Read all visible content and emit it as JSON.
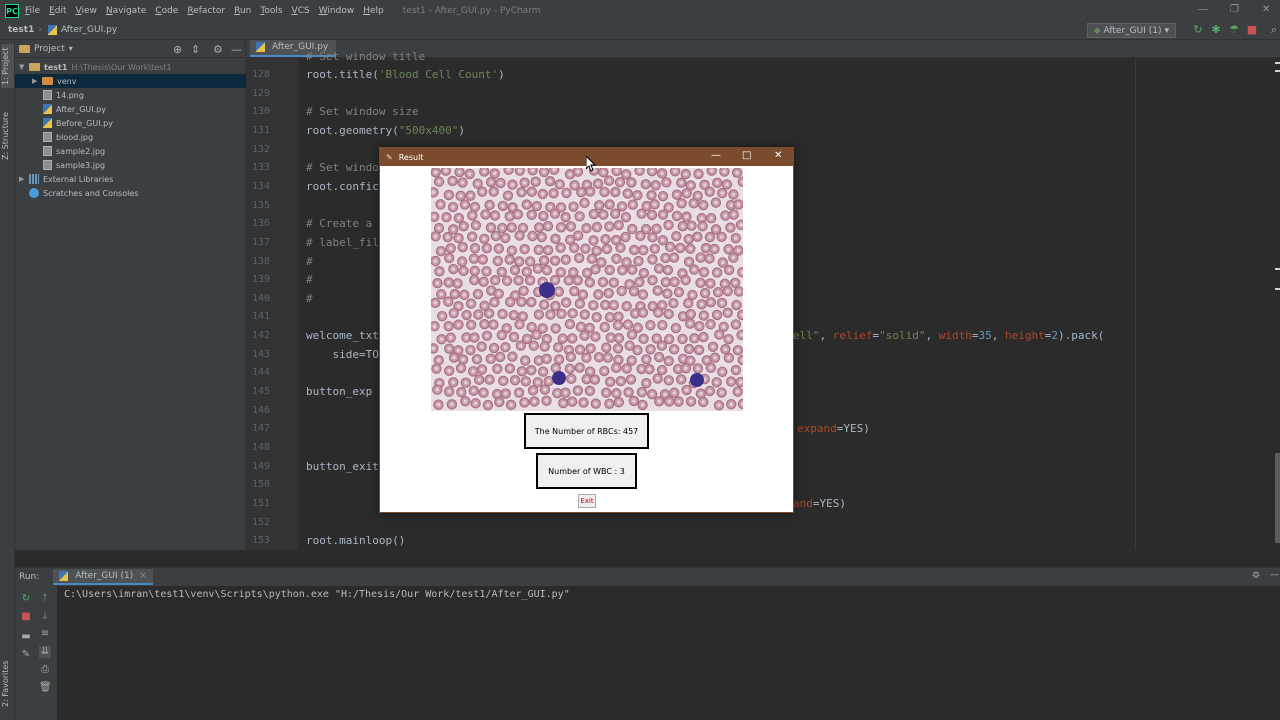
{
  "app": {
    "window_title": "test1 - After_GUI.py - PyCharm",
    "logo_text": "PC"
  },
  "menu": [
    {
      "label": "File",
      "mnemonic": "F",
      "rest": "ile"
    },
    {
      "label": "Edit",
      "mnemonic": "E",
      "rest": "dit"
    },
    {
      "label": "View",
      "mnemonic": "V",
      "rest": "iew"
    },
    {
      "label": "Navigate",
      "mnemonic": "N",
      "rest": "avigate"
    },
    {
      "label": "Code",
      "mnemonic": "C",
      "rest": "ode"
    },
    {
      "label": "Refactor",
      "mnemonic": "R",
      "rest": "efactor"
    },
    {
      "label": "Run",
      "mnemonic": "R",
      "rest": "un"
    },
    {
      "label": "Tools",
      "mnemonic": "T",
      "rest": "ools"
    },
    {
      "label": "VCS",
      "mnemonic": "V",
      "rest": "CS"
    },
    {
      "label": "Window",
      "mnemonic": "W",
      "rest": "indow"
    },
    {
      "label": "Help",
      "mnemonic": "H",
      "rest": "elp"
    }
  ],
  "navbar": {
    "project": "test1",
    "file": "After_GUI.py",
    "run_config": "After_GUI (1)"
  },
  "left_stripe": {
    "project_tab": "1: Project",
    "structure_tab": "Z: Structure",
    "favorites_tab": "2: Favorites"
  },
  "project_panel": {
    "title": "Project",
    "root": {
      "name": "test1",
      "path": "H:\\Thesis\\Our Work\\test1"
    },
    "items": [
      {
        "name": "venv",
        "kind": "folder"
      },
      {
        "name": "14.png",
        "kind": "image"
      },
      {
        "name": "After_GUI.py",
        "kind": "python"
      },
      {
        "name": "Before_GUI.py",
        "kind": "python"
      },
      {
        "name": "blood.jpg",
        "kind": "image"
      },
      {
        "name": "sample2.jpg",
        "kind": "image"
      },
      {
        "name": "sample3.jpg",
        "kind": "image"
      }
    ],
    "external_libraries": "External Libraries",
    "scratches": "Scratches and Consoles"
  },
  "editor": {
    "tab": "After_GUI.py",
    "top_partial": "# Set window title",
    "lines": [
      {
        "n": "128",
        "a": "root.title(",
        "b": "'Blood Cell Count'",
        "c": ")"
      },
      {
        "n": "129"
      },
      {
        "n": "130",
        "comment": "# Set window size"
      },
      {
        "n": "131",
        "a": "root.geometry(",
        "b": "\"500x400\"",
        "c": ")"
      },
      {
        "n": "132"
      },
      {
        "n": "133",
        "comment": "# Set windo"
      },
      {
        "n": "134",
        "a": "root.confic"
      },
      {
        "n": "135"
      },
      {
        "n": "136",
        "comment": "# Create a"
      },
      {
        "n": "137",
        "comment": "# label_fil"
      },
      {
        "n": "138",
        "comment": "#"
      },
      {
        "n": "139",
        "comment": "#"
      },
      {
        "n": "140",
        "comment": "#"
      },
      {
        "n": "141"
      },
      {
        "n": "142",
        "a": "welcome_txt"
      },
      {
        "n": "143",
        "a": "    side=TO"
      },
      {
        "n": "144"
      },
      {
        "n": "145",
        "a": "button_exp"
      },
      {
        "n": "146"
      },
      {
        "n": "147"
      },
      {
        "n": "148"
      },
      {
        "n": "149",
        "a": "button_exit"
      },
      {
        "n": "150"
      },
      {
        "n": "151"
      },
      {
        "n": "152"
      },
      {
        "n": "153",
        "a": "root.mainloop()"
      }
    ],
    "line142_right": {
      "s1": "ell\"",
      "s2": ", ",
      "k1": "relief",
      "s3": "=",
      "v1": "\"solid\"",
      "s4": ", ",
      "k2": "width",
      "s5": "=",
      "n1": "35",
      "s6": ", ",
      "k3": "height",
      "s7": "=",
      "n2": "2",
      "s8": ").pack("
    },
    "line147_right": {
      "k": "expand",
      "r": "=YES)"
    },
    "line151_right": {
      "k": "and",
      "r": "=YES)"
    }
  },
  "run_panel": {
    "label": "Run:",
    "tab": "After_GUI (1)",
    "console": "C:\\Users\\imran\\test1\\venv\\Scripts\\python.exe \"H:/Thesis/Our Work/test1/After_GUI.py\""
  },
  "result_window": {
    "title": "Result",
    "rbc_text": "The Number of RBCs: 457",
    "wbc_text": "Number of WBC : 3",
    "exit_label": "Exit"
  },
  "colors": {
    "accent": "#4a88c7",
    "tk_title": "#7a4b2c",
    "exit_text": "#d00000"
  }
}
